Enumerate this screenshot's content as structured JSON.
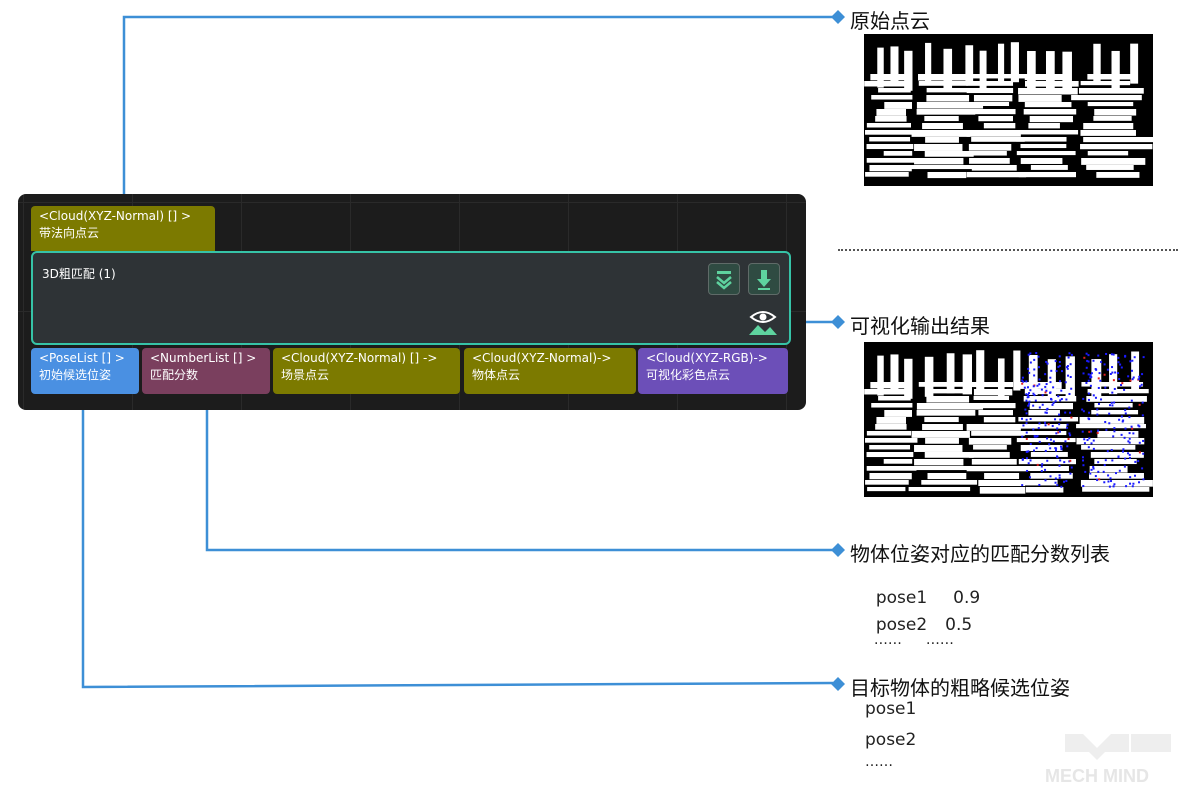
{
  "node": {
    "title": "3D粗匹配 (1)",
    "input_port": {
      "type": "<Cloud(XYZ-Normal) [] >",
      "name": "带法向点云"
    },
    "output_ports": [
      {
        "type": "<PoseList [] >",
        "name": "初始候选位姿",
        "color": "#4a90e2"
      },
      {
        "type": "<NumberList [] >",
        "name": "匹配分数",
        "color": "#7a3f5e"
      },
      {
        "type": "<Cloud(XYZ-Normal) [] ->",
        "name": "场景点云",
        "color": "#7c7a00"
      },
      {
        "type": "<Cloud(XYZ-Normal)->",
        "name": "物体点云",
        "color": "#7c7a00"
      },
      {
        "type": "<Cloud(XYZ-RGB)->",
        "name": "可视化彩色点云",
        "color": "#6c4fb8"
      }
    ],
    "icons": [
      "chevron-collapse-icon",
      "download-arrow-icon",
      "visualize-eye-icon"
    ],
    "accent_color": "#36c3a7"
  },
  "callouts": {
    "original_cloud": "原始点云",
    "visual_output": "可视化输出结果",
    "score_list": "物体位姿对应的匹配分数列表",
    "candidate_poses": "目标物体的粗略候选位姿"
  },
  "score_rows": [
    {
      "pose": "pose1",
      "score": "0.9"
    },
    {
      "pose": "pose2",
      "score": "0.5"
    },
    {
      "pose": "……",
      "score": "……"
    }
  ],
  "pose_rows": [
    "pose1",
    "pose2",
    "……"
  ],
  "watermark": "MECH MIND",
  "connector_color": "#4a90e2"
}
